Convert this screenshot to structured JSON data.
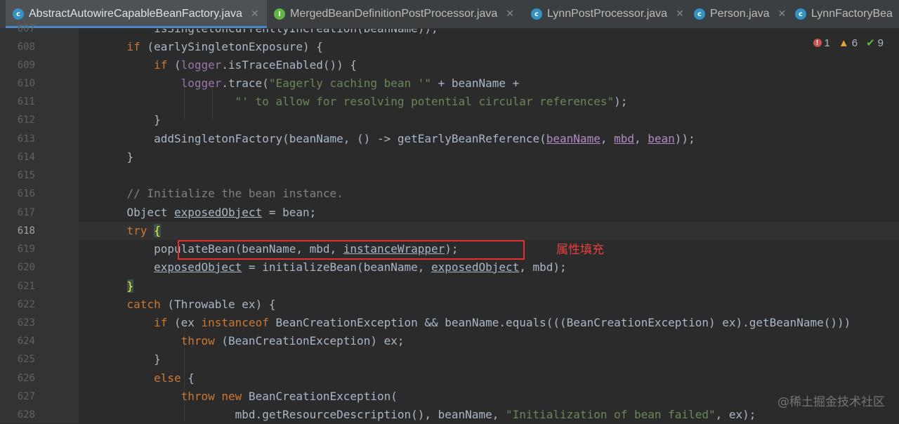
{
  "tabs": [
    {
      "label": "AbstractAutowireCapableBeanFactory.java",
      "icon": "class-icon",
      "active": true,
      "closable": true
    },
    {
      "label": "MergedBeanDefinitionPostProcessor.java",
      "icon": "interface-icon",
      "active": false,
      "closable": true
    },
    {
      "label": "LynnPostProcessor.java",
      "icon": "class-icon",
      "active": false,
      "closable": true
    },
    {
      "label": "Person.java",
      "icon": "class-icon",
      "active": false,
      "closable": true
    },
    {
      "label": "LynnFactoryBea",
      "icon": "class-icon",
      "active": false,
      "closable": false
    }
  ],
  "inspections": {
    "errors": "1",
    "warnings": "6",
    "weak_warnings": "9"
  },
  "line_numbers": [
    "608",
    "609",
    "610",
    "611",
    "612",
    "613",
    "614",
    "615",
    "616",
    "617",
    "618",
    "619",
    "620",
    "621",
    "622",
    "623",
    "624",
    "625",
    "626",
    "627",
    "628"
  ],
  "current_line": "618",
  "annotation": "属性填充",
  "watermark": "@稀土掘金技术社区",
  "colors": {
    "keyword": "#cc7832",
    "string": "#6a8759",
    "field": "#9876aa",
    "comment": "#808080",
    "highlight_box": "#e53030"
  }
}
